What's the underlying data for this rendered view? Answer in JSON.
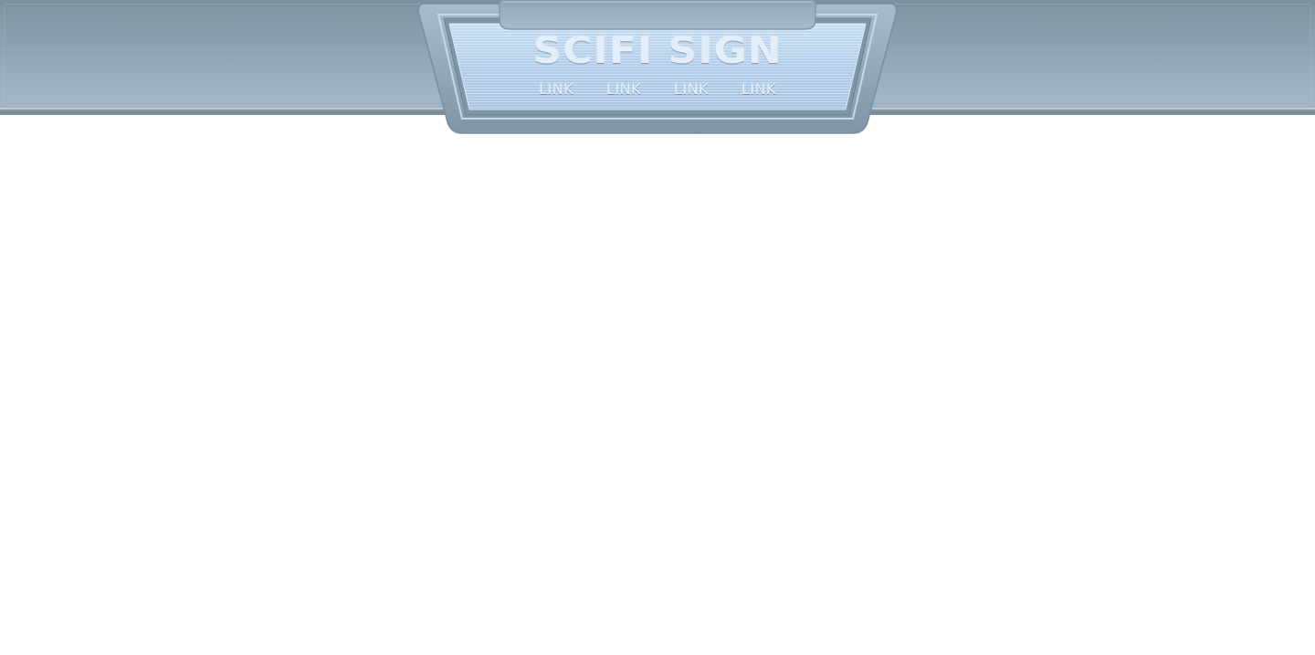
{
  "header": {
    "title": "SCIFI SIGN",
    "nav": [
      {
        "label": "LINK"
      },
      {
        "label": "LINK"
      },
      {
        "label": "LINK"
      },
      {
        "label": "LINK"
      }
    ]
  },
  "colors": {
    "bar": "#8ea2b1",
    "sign_face": "#b4d0ea",
    "sign_frame": "#94abbd",
    "text": "#e4eef8",
    "background": "#ffffff"
  }
}
